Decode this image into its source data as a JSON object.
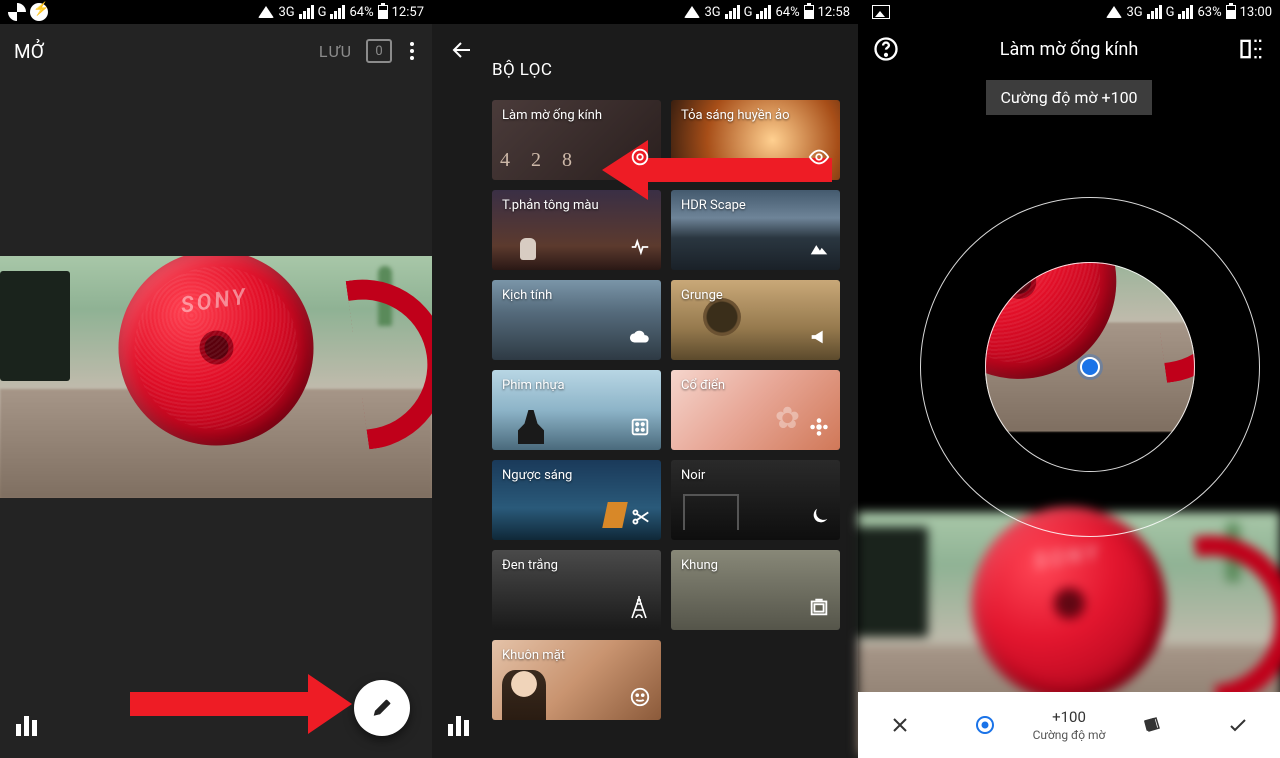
{
  "panel1": {
    "status": {
      "network1": "3G",
      "network2": "G",
      "battery_pct": "64%",
      "time": "12:57"
    },
    "open_label": "MỞ",
    "save_label": "LƯU",
    "counter": "0",
    "photo_brand": "SONY"
  },
  "panel2": {
    "status": {
      "network1": "3G",
      "network2": "G",
      "battery_pct": "64%",
      "time": "12:58"
    },
    "title": "BỘ LỌC",
    "filters": [
      {
        "label": "Làm mờ ống kính",
        "icon": "lens"
      },
      {
        "label": "Tỏa sáng huyền ảo",
        "icon": "eye"
      },
      {
        "label": "T.phản tông màu",
        "icon": "pulse"
      },
      {
        "label": "HDR Scape",
        "icon": "mountain"
      },
      {
        "label": "Kịch tính",
        "icon": "cloud"
      },
      {
        "label": "Grunge",
        "icon": "megaphone"
      },
      {
        "label": "Phim nhựa",
        "icon": "dice"
      },
      {
        "label": "Cổ điển",
        "icon": "flower"
      },
      {
        "label": "Ngược sáng",
        "icon": "scissors"
      },
      {
        "label": "Noir",
        "icon": "moon"
      },
      {
        "label": "Đen trắng",
        "icon": "tower"
      },
      {
        "label": "Khung",
        "icon": "frame"
      },
      {
        "label": "Khuôn mặt",
        "icon": "face"
      }
    ]
  },
  "panel3": {
    "status": {
      "network1": "3G",
      "network2": "G",
      "battery_pct": "63%",
      "time": "13:00"
    },
    "title": "Làm mờ ống kính",
    "chip": "Cường độ mờ +100",
    "photo_brand": "SONY",
    "bottom": {
      "value": "+100",
      "label": "Cường độ mờ"
    }
  }
}
